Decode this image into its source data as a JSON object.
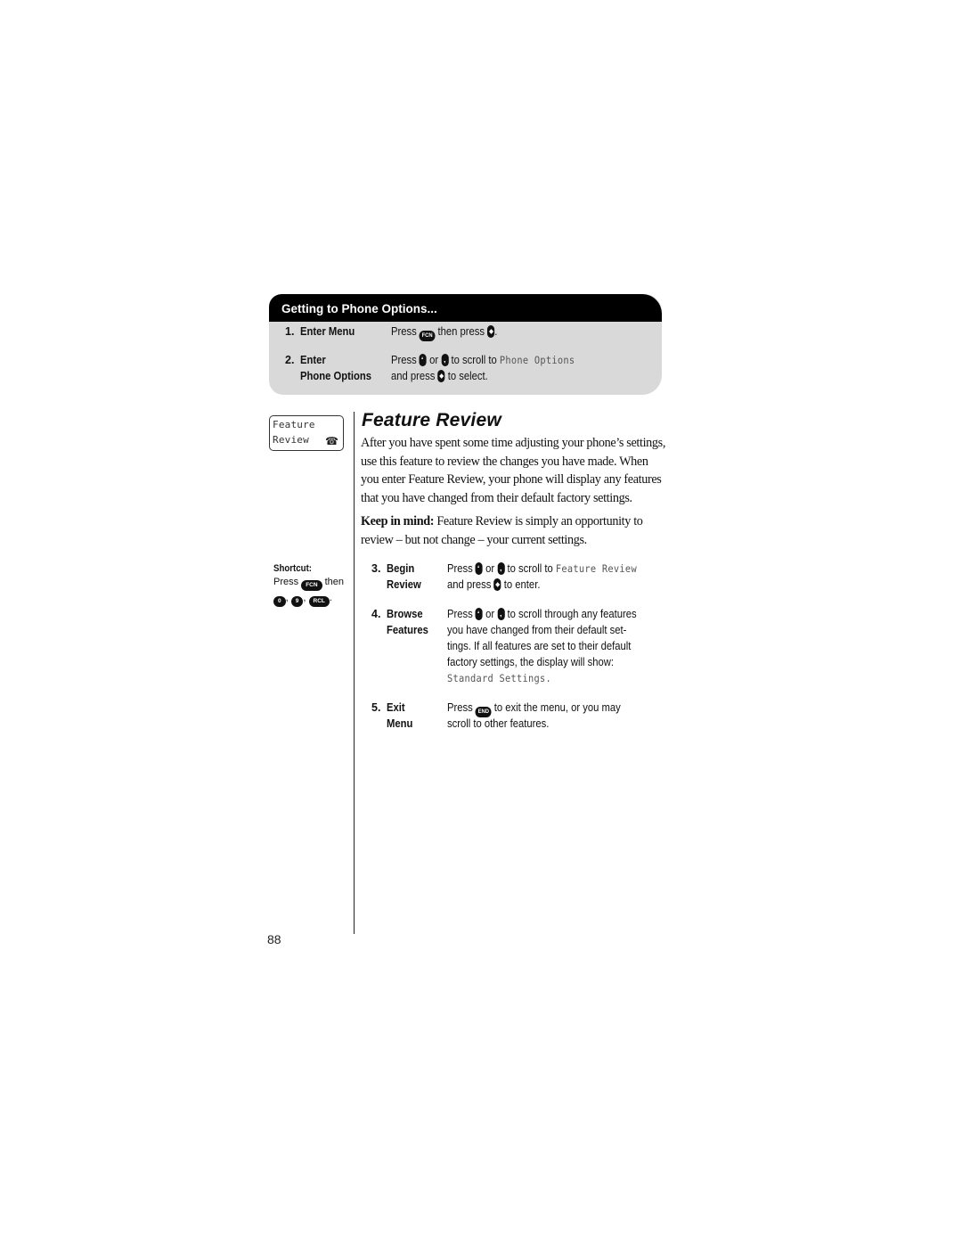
{
  "options_box": {
    "title": "Getting to Phone Options...",
    "steps": [
      {
        "num": "1.",
        "label_line1": "Enter Menu",
        "label_line2": "",
        "press": "Press",
        "key1": "FCN",
        "then_press": "then press",
        "end": "."
      },
      {
        "num": "2.",
        "label_line1": "Enter",
        "label_line2": "Phone Options",
        "press": "Press",
        "or": "or",
        "scroll_to": "to scroll to",
        "lcd_target": "Phone Options",
        "and_press": "and press",
        "to_select": "to select."
      }
    ]
  },
  "display": {
    "line1": "Feature",
    "line2": "Review",
    "icon": "phone-icon"
  },
  "shortcut": {
    "title": "Shortcut:",
    "press": "Press",
    "key": "FCN",
    "then": "then",
    "keys": [
      "0",
      "9",
      "RCL"
    ],
    "sep": ",",
    "end": "."
  },
  "section": {
    "title": "Feature Review",
    "intro": "After you have spent some time adjusting your phone’s settings, use this feature to review the changes you have made. When you enter Feature Review, your phone will display any features that you have changed from their default factory settings.",
    "keep_in_mind_label": "Keep in mind:",
    "keep_in_mind_text": " Feature Review is simply an opportunity to review – but not change – your current settings."
  },
  "steps": [
    {
      "num": "3.",
      "label_line1": "Begin",
      "label_line2": "Review",
      "press": "Press",
      "or": "or",
      "scroll_to": "to scroll to",
      "lcd_target": "Feature Review",
      "and_press": "and press",
      "to_enter": "to enter."
    },
    {
      "num": "4.",
      "label_line1": "Browse",
      "label_line2": "Features",
      "press": "Press",
      "or": "or",
      "line1_rest": "to scroll through any features",
      "line2": "you have changed from their default set-",
      "line3": "tings. If all features are set to their default",
      "line4": "factory settings, the display will show:",
      "lcd_text": "Standard Settings",
      "lcd_end": "."
    },
    {
      "num": "5.",
      "label_line1": "Exit",
      "label_line2": "Menu",
      "press": "Press",
      "key": "END",
      "line1_rest": "to exit the menu, or you may",
      "line2": "scroll to other features."
    }
  ],
  "page_number": "88"
}
